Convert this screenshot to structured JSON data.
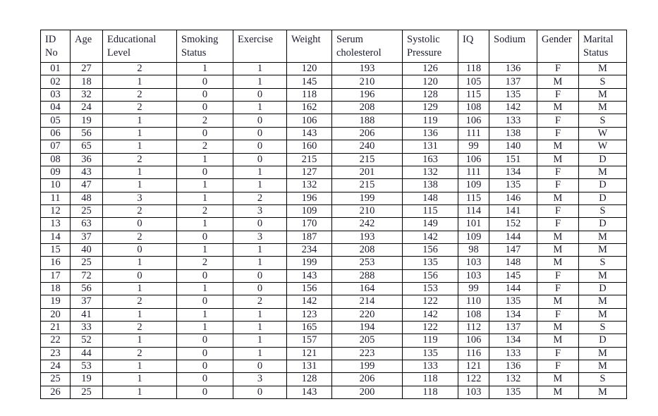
{
  "table": {
    "columns": [
      {
        "key": "id",
        "label": "ID\nNo",
        "class": "c-id"
      },
      {
        "key": "age",
        "label": "Age",
        "class": "c-age"
      },
      {
        "key": "edu",
        "label": "Educational\nLevel",
        "class": "c-edu"
      },
      {
        "key": "smoke",
        "label": "Smoking\nStatus",
        "class": "c-smoke"
      },
      {
        "key": "ex",
        "label": "Exercise",
        "class": "c-ex"
      },
      {
        "key": "weight",
        "label": "Weight",
        "class": "c-weight"
      },
      {
        "key": "serum",
        "label": "Serum\ncholesterol",
        "class": "c-serum"
      },
      {
        "key": "sys",
        "label": "Systolic\nPressure",
        "class": "c-sys"
      },
      {
        "key": "iq",
        "label": "IQ",
        "class": "c-iq"
      },
      {
        "key": "sodium",
        "label": "Sodium",
        "class": "c-sodium"
      },
      {
        "key": "gender",
        "label": "Gender",
        "class": "c-gender"
      },
      {
        "key": "marital",
        "label": "Marital\nStatus",
        "class": "c-marital"
      }
    ],
    "rows": [
      [
        "01",
        "27",
        "2",
        "1",
        "1",
        "120",
        "193",
        "126",
        "118",
        "136",
        "F",
        "M"
      ],
      [
        "02",
        "18",
        "1",
        "0",
        "1",
        "145",
        "210",
        "120",
        "105",
        "137",
        "M",
        "S"
      ],
      [
        "03",
        "32",
        "2",
        "0",
        "0",
        "118",
        "196",
        "128",
        "115",
        "135",
        "F",
        "M"
      ],
      [
        "04",
        "24",
        "2",
        "0",
        "1",
        "162",
        "208",
        "129",
        "108",
        "142",
        "M",
        "M"
      ],
      [
        "05",
        "19",
        "1",
        "2",
        "0",
        "106",
        "188",
        "119",
        "106",
        "133",
        "F",
        "S"
      ],
      [
        "06",
        "56",
        "1",
        "0",
        "0",
        "143",
        "206",
        "136",
        "111",
        "138",
        "F",
        "W"
      ],
      [
        "07",
        "65",
        "1",
        "2",
        "0",
        "160",
        "240",
        "131",
        "99",
        "140",
        "M",
        "W"
      ],
      [
        "08",
        "36",
        "2",
        "1",
        "0",
        "215",
        "215",
        "163",
        "106",
        "151",
        "M",
        "D"
      ],
      [
        "09",
        "43",
        "1",
        "0",
        "1",
        "127",
        "201",
        "132",
        "111",
        "134",
        "F",
        "M"
      ],
      [
        "10",
        "47",
        "1",
        "1",
        "1",
        "132",
        "215",
        "138",
        "109",
        "135",
        "F",
        "D"
      ],
      [
        "11",
        "48",
        "3",
        "1",
        "2",
        "196",
        "199",
        "148",
        "115",
        "146",
        "M",
        "D"
      ],
      [
        "12",
        "25",
        "2",
        "2",
        "3",
        "109",
        "210",
        "115",
        "114",
        "141",
        "F",
        "S"
      ],
      [
        "13",
        "63",
        "0",
        "1",
        "0",
        "170",
        "242",
        "149",
        "101",
        "152",
        "F",
        "D"
      ],
      [
        "14",
        "37",
        "2",
        "0",
        "3",
        "187",
        "193",
        "142",
        "109",
        "144",
        "M",
        "M"
      ],
      [
        "15",
        "40",
        "0",
        "1",
        "1",
        "234",
        "208",
        "156",
        "98",
        "147",
        "M",
        "M"
      ],
      [
        "16",
        "25",
        "1",
        "2",
        "1",
        "199",
        "253",
        "135",
        "103",
        "148",
        "M",
        "S"
      ],
      [
        "17",
        "72",
        "0",
        "0",
        "0",
        "143",
        "288",
        "156",
        "103",
        "145",
        "F",
        "M"
      ],
      [
        "18",
        "56",
        "1",
        "1",
        "0",
        "156",
        "164",
        "153",
        "99",
        "144",
        "F",
        "D"
      ],
      [
        "19",
        "37",
        "2",
        "0",
        "2",
        "142",
        "214",
        "122",
        "110",
        "135",
        "M",
        "M"
      ],
      [
        "20",
        "41",
        "1",
        "1",
        "1",
        "123",
        "220",
        "142",
        "108",
        "134",
        "F",
        "M"
      ],
      [
        "21",
        "33",
        "2",
        "1",
        "1",
        "165",
        "194",
        "122",
        "112",
        "137",
        "M",
        "S"
      ],
      [
        "22",
        "52",
        "1",
        "0",
        "1",
        "157",
        "205",
        "119",
        "106",
        "134",
        "M",
        "D"
      ],
      [
        "23",
        "44",
        "2",
        "0",
        "1",
        "121",
        "223",
        "135",
        "116",
        "133",
        "F",
        "M"
      ],
      [
        "24",
        "53",
        "1",
        "0",
        "0",
        "131",
        "199",
        "133",
        "121",
        "136",
        "F",
        "M"
      ],
      [
        "25",
        "19",
        "1",
        "0",
        "3",
        "128",
        "206",
        "118",
        "122",
        "132",
        "M",
        "S"
      ],
      [
        "26",
        "25",
        "1",
        "0",
        "0",
        "143",
        "200",
        "118",
        "103",
        "135",
        "M",
        "M"
      ]
    ]
  },
  "colors": {
    "page_background": "#ffffff",
    "text": "#1b1b2f",
    "border": "#000000"
  }
}
